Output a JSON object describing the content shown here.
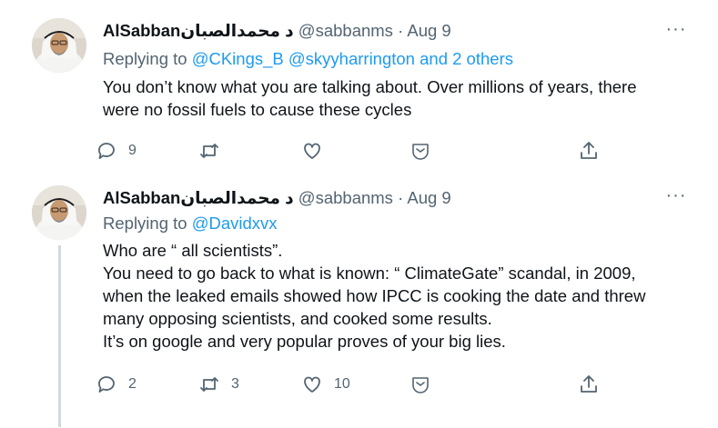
{
  "tweets": [
    {
      "display_name": "AlSabban",
      "display_name_arabic": "د محمدالصبان",
      "handle": "@sabbanms",
      "separator": "·",
      "date": "Aug 9",
      "more_label": "···",
      "replying_prefix": "Replying to",
      "replying_to": [
        "@CKings_B",
        "@skyyharrington",
        "and 2 others"
      ],
      "body_lines": [
        "You don’t know what you are talking about. Over millions of years, there",
        "were no fossil fuels to cause these cycles"
      ],
      "counts": {
        "replies": "9",
        "retweets": "",
        "likes": ""
      },
      "icons": [
        "reply-icon",
        "retweet-icon",
        "like-icon",
        "moderation-icon",
        "share-icon"
      ]
    },
    {
      "display_name": "AlSabban",
      "display_name_arabic": "د محمدالصبان",
      "handle": "@sabbanms",
      "separator": "·",
      "date": "Aug 9",
      "more_label": "···",
      "replying_prefix": "Replying to",
      "replying_to": [
        "@Davidxvx"
      ],
      "body_lines": [
        "Who are “ all scientists”.",
        "You need to go back to what is known: “ ClimateGate” scandal, in 2009,",
        "when the leaked emails showed how IPCC is cooking the date and threw",
        "many opposing scientists, and cooked some results.",
        "It’s on google and very popular proves of your big lies."
      ],
      "counts": {
        "replies": "2",
        "retweets": "3",
        "likes": "10"
      },
      "icons": [
        "reply-icon",
        "retweet-icon",
        "like-icon",
        "moderation-icon",
        "share-icon"
      ]
    }
  ],
  "colors": {
    "text": "#0f1419",
    "secondary": "#536471",
    "link": "#1d9bf0",
    "thread_line": "#cfd9de"
  }
}
